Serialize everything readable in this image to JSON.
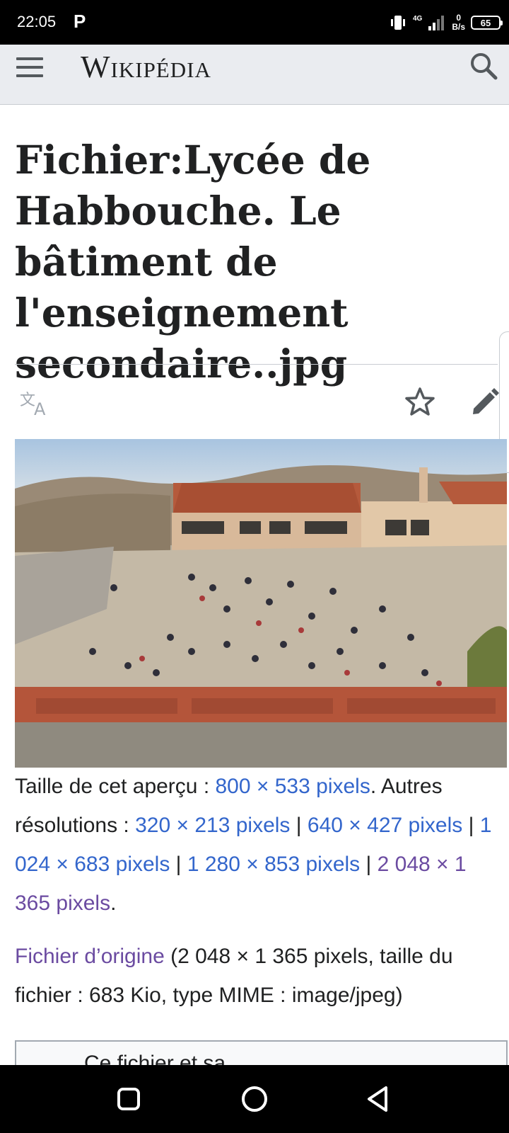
{
  "status_bar": {
    "time": "22:05",
    "app_indicator": "P",
    "network_generation": "4G",
    "net_speed_value": "0",
    "net_speed_unit": "B/s",
    "battery_level": "65",
    "icons": [
      "vibrate-icon",
      "signal-icon",
      "battery-icon"
    ]
  },
  "header": {
    "wordmark": "Wikipédia",
    "icons": [
      "menu-icon",
      "search-icon"
    ]
  },
  "page": {
    "title": "Fichier:Lycée de Habbouche. Le bâtiment de l'enseignement secondaire..jpg",
    "action_icons": [
      "language-icon",
      "star-icon",
      "edit-icon"
    ]
  },
  "image": {
    "subject": "school courtyard photo"
  },
  "preview": {
    "size_prefix": "Taille de cet aperçu : ",
    "size_link": "800 × 533 pixels",
    "other_prefix": ". Autres résolutions : ",
    "res_1": "320 × 213 pixels",
    "res_2": "640 × 427 pixels",
    "res_3": "1 024 × 683 pixels",
    "res_4": "1 280 × 853 pixels",
    "res_5": "2 048 × 1 365 pixels",
    "separator": " | ",
    "end": "."
  },
  "original": {
    "link_label": "Fichier d’origine",
    "details": " (2 048 × 1 365 pixels, taille du fichier : 683 Kio, type MIME : image/jpeg)"
  },
  "license": {
    "partial_text": "Ce fichier et sa"
  },
  "nav_bar": {
    "icons": [
      "recents-icon",
      "home-icon",
      "back-icon"
    ]
  },
  "colors": {
    "link": "#3366cc",
    "visited_link": "#6b4ba1",
    "header_bg": "#eaecf0"
  }
}
